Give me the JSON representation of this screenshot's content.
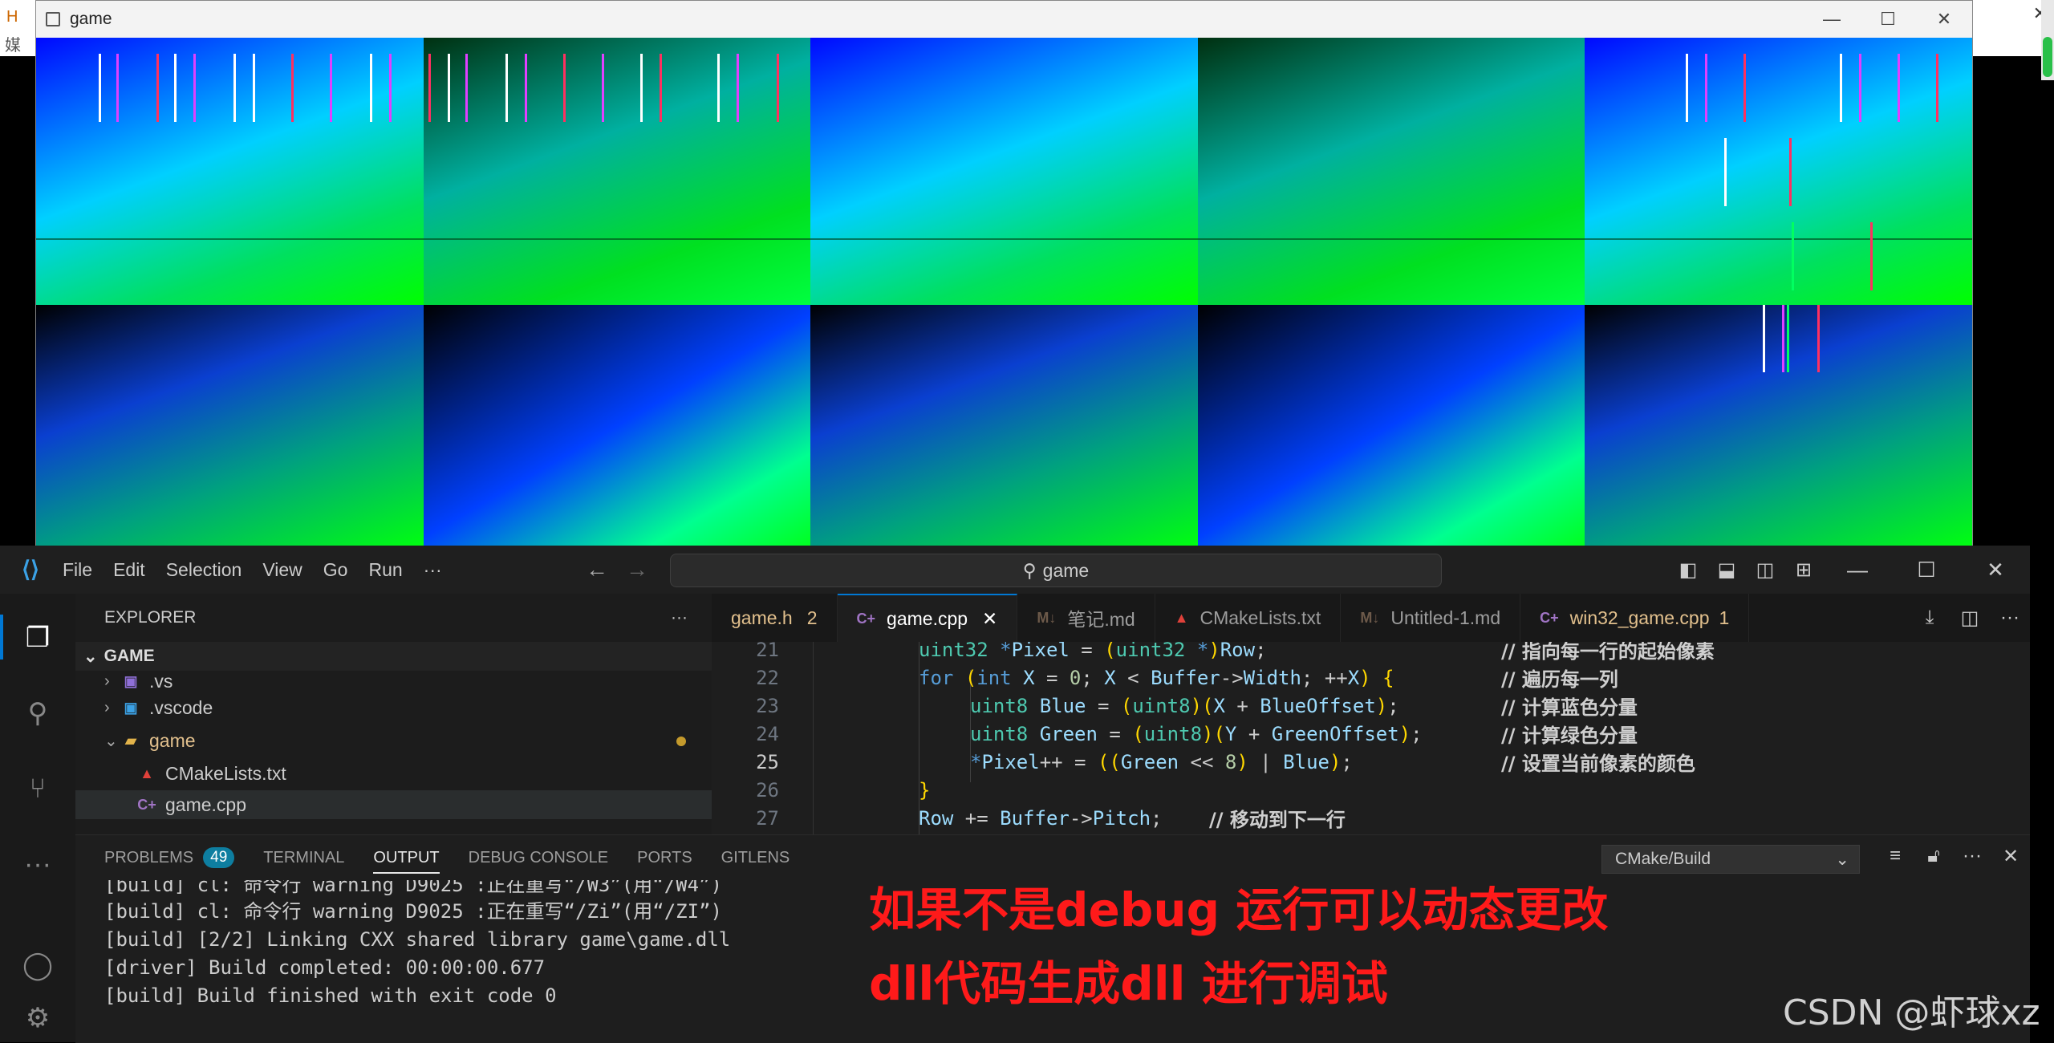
{
  "game_window": {
    "title": "game",
    "controls": [
      "—",
      "☐",
      "✕"
    ]
  },
  "bg_window": {
    "left_text_1": "H",
    "left_text_2": "媒",
    "close": "✕"
  },
  "vscode": {
    "menu": [
      "File",
      "Edit",
      "Selection",
      "View",
      "Go",
      "Run",
      "···"
    ],
    "search": "game",
    "explorer": {
      "header": "EXPLORER",
      "more": "···",
      "section": "GAME",
      "items": [
        {
          "label": ".vs",
          "type": "folder-closed"
        },
        {
          "label": ".vscode",
          "type": "folder-closed"
        },
        {
          "label": "game",
          "type": "folder-open"
        },
        {
          "label": "CMakeLists.txt",
          "type": "file"
        },
        {
          "label": "game.cpp",
          "type": "file"
        }
      ]
    },
    "tabs": [
      {
        "label": "game.h",
        "badge": "2",
        "color": "#e2c08d"
      },
      {
        "label": "game.cpp",
        "badge": "✕",
        "color": "#ffffff"
      },
      {
        "label": "笔记.md",
        "badge": "",
        "color": "#9d9d9d"
      },
      {
        "label": "CMakeLists.txt",
        "badge": "",
        "color": "#9d9d9d"
      },
      {
        "label": "Untitled-1.md",
        "badge": "",
        "color": "#9d9d9d"
      },
      {
        "label": "win32_game.cpp",
        "badge": "1",
        "color": "#e2c08d"
      }
    ],
    "code": {
      "line_numbers": [
        "21",
        "22",
        "23",
        "24",
        "25",
        "26",
        "27"
      ],
      "comments": [
        "// 指向每一行的起始像素",
        "// 遍历每一列",
        "// 计算蓝色分量",
        "// 计算绿色分量",
        "// 设置当前像素的颜色",
        "",
        "// 移动到下一行"
      ]
    },
    "panel": {
      "tabs": [
        "PROBLEMS",
        "TERMINAL",
        "OUTPUT",
        "DEBUG CONSOLE",
        "PORTS",
        "GITLENS"
      ],
      "problems_count": "49",
      "output_source": "CMake/Build",
      "lines": [
        "[build] cl: 命令行 warning D9025 :正在重写“/W3”(用“/W4”)",
        "[build] cl: 命令行 warning D9025 :正在重写“/Zi”(用“/ZI”)",
        "[build] [2/2] Linking CXX shared library game\\game.dll",
        "[driver] Build completed: 00:00:00.677",
        "[build] Build finished with exit code 0"
      ]
    }
  },
  "overlay_note": {
    "line1": "如果不是debug  运行可以动态更改",
    "line2": "dll代码生成dll 进行调试"
  },
  "watermark": "CSDN @虾球xz"
}
